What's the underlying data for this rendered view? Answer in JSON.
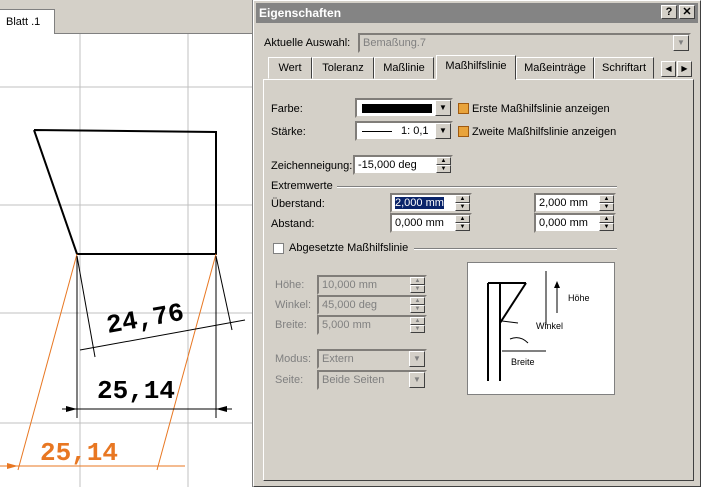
{
  "sheet_tab": "Blatt .1",
  "drawing": {
    "dim_inclined": "24,76",
    "dim_horizontal": "25,14",
    "dim_selected": "25,14",
    "dim_selected_color": "#e87722"
  },
  "dialog": {
    "title": "Eigenschaften",
    "help_btn": "?",
    "close_btn": "✕",
    "selection_label": "Aktuelle Auswahl:",
    "selection_value": "Bemaßung.7",
    "tabs": [
      "Wert",
      "Toleranz",
      "Maßlinie",
      "Maßhilfslinie",
      "Maßeinträge",
      "Schriftart"
    ],
    "active_tab": "Maßhilfslinie",
    "color_label": "Farbe:",
    "color_value": "#000000",
    "thickness_label": "Stärke:",
    "thickness_value": "1: 0,1",
    "first_line_label": "Erste Maßhilfslinie anzeigen",
    "second_line_label": "Zweite Maßhilfslinie anzeigen",
    "slant_label": "Zeichenneigung:",
    "slant_value": "-15,000 deg",
    "extrema_group": "Extremwerte",
    "overrun_label": "Überstand:",
    "overrun_1": "2,000 mm",
    "overrun_2": "2,000 mm",
    "gap_label": "Abstand:",
    "gap_1": "0,000 mm",
    "gap_2": "0,000 mm",
    "funnel_label": "Abgesetzte Maßhilfslinie",
    "height_label": "Höhe:",
    "height_value": "10,000 mm",
    "angle_label": "Winkel:",
    "angle_value": "45,000 deg",
    "width_label": "Breite:",
    "width_value": "5,000 mm",
    "mode_label": "Modus:",
    "mode_value": "Extern",
    "side_label": "Seite:",
    "side_value": "Beide Seiten",
    "preview_height": "Höhe",
    "preview_angle": "Winkel",
    "preview_width": "Breite"
  }
}
